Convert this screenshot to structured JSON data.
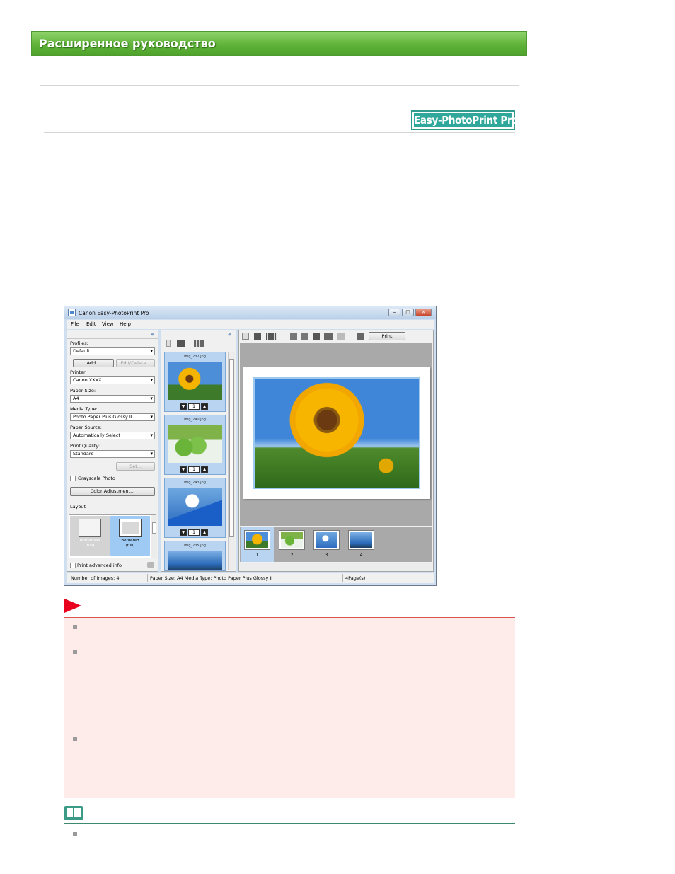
{
  "header": {
    "title": "Расширенное руководство",
    "logo_text": "Easy-PhotoPrint Pro"
  },
  "app": {
    "window_title": "Canon Easy-PhotoPrint Pro",
    "window_controls": [
      "–",
      "□",
      "×"
    ],
    "menu": [
      "File",
      "Edit",
      "View",
      "Help"
    ],
    "settings": {
      "profiles_label": "Profiles:",
      "profiles_value": "Default",
      "add_label": "Add...",
      "edit_delete_label": "Edit/Delete...",
      "printer_label": "Printer:",
      "printer_value": "Canon XXXX",
      "paper_size_label": "Paper Size:",
      "paper_size_value": "A4",
      "media_type_label": "Media Type:",
      "media_type_value": "Photo Paper Plus Glossy II",
      "paper_source_label": "Paper Source:",
      "paper_source_value": "Automatically Select",
      "print_quality_label": "Print Quality:",
      "print_quality_value": "Standard",
      "set_label": "Set...",
      "grayscale_label": "Grayscale Photo",
      "color_adjust_label": "Color Adjustment...",
      "layout_label": "Layout",
      "layouts": [
        {
          "line1": "Borderless",
          "line2": "(full)"
        },
        {
          "line1": "Bordered",
          "line2": "(full)"
        }
      ],
      "advanced_info_label": "Print advanced info"
    },
    "thumbnails": [
      {
        "name": "img_237.jpg",
        "count": "1",
        "image": "sunflower"
      },
      {
        "name": "img_240.jpg",
        "count": "1",
        "image": "apples"
      },
      {
        "name": "img_243.jpg",
        "count": "1",
        "image": "flower-glass"
      },
      {
        "name": "img_235.jpg",
        "image": "palm-beach"
      }
    ],
    "print_label": "Print",
    "pages": [
      "1",
      "2",
      "3",
      "4"
    ],
    "status": {
      "images": "Number of images: 4",
      "paper": "Paper Size: A4  Media Type: Photo Paper Plus Glossy II",
      "pages": "4Page(s)"
    }
  }
}
